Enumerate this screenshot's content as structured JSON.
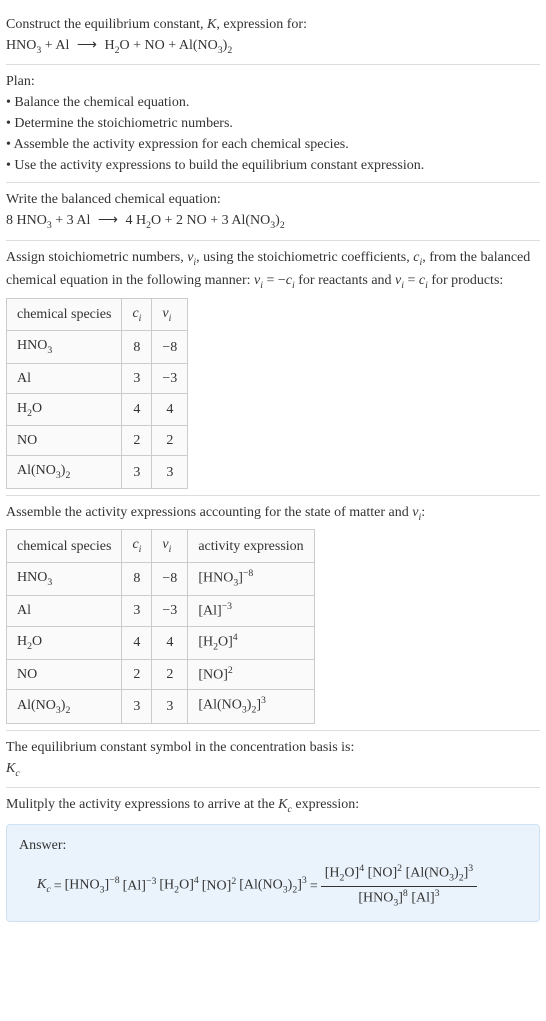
{
  "header": {
    "line1_a": "Construct the equilibrium constant, ",
    "line1_b": ", expression for:",
    "K": "K",
    "eq_lhs_1": "HNO",
    "eq_lhs_1_sub": "3",
    "plus": " + ",
    "eq_lhs_2": "Al",
    "arrow": "⟶",
    "eq_rhs_1": "H",
    "eq_rhs_1_sub": "2",
    "eq_rhs_1b": "O",
    "eq_rhs_2": "NO",
    "eq_rhs_3a": "Al(NO",
    "eq_rhs_3_sub1": "3",
    "eq_rhs_3b": ")",
    "eq_rhs_3_sub2": "2"
  },
  "plan": {
    "title": "Plan:",
    "b1": "• Balance the chemical equation.",
    "b2": "• Determine the stoichiometric numbers.",
    "b3": "• Assemble the activity expression for each chemical species.",
    "b4": "• Use the activity expressions to build the equilibrium constant expression."
  },
  "balanced": {
    "intro": "Write the balanced chemical equation:",
    "c1": "8 HNO",
    "c1_sub": "3",
    "c2": " + 3 Al",
    "arrow": "⟶",
    "c3": "4 H",
    "c3_sub": "2",
    "c3b": "O",
    "c4": " + 2 NO",
    "c5a": " + 3 Al(NO",
    "c5_sub1": "3",
    "c5b": ")",
    "c5_sub2": "2"
  },
  "stoich_intro": {
    "a": "Assign stoichiometric numbers, ",
    "nu": "ν",
    "i": "i",
    "b": ", using the stoichiometric coefficients, ",
    "c": "c",
    "d": ", from the balanced chemical equation in the following manner: ",
    "rule1a": "ν",
    "rule1b": " = −",
    "rule1c": "c",
    "e": " for reactants and ",
    "rule2a": "ν",
    "rule2b": " = ",
    "rule2c": "c",
    "f": " for products:"
  },
  "table1": {
    "h1": "chemical species",
    "h2_a": "c",
    "h2_b": "i",
    "h3_a": "ν",
    "h3_b": "i",
    "r1": {
      "sp_a": "HNO",
      "sp_sub": "3",
      "c": "8",
      "nu": "−8"
    },
    "r2": {
      "sp": "Al",
      "c": "3",
      "nu": "−3"
    },
    "r3": {
      "sp_a": "H",
      "sp_sub": "2",
      "sp_b": "O",
      "c": "4",
      "nu": "4"
    },
    "r4": {
      "sp": "NO",
      "c": "2",
      "nu": "2"
    },
    "r5": {
      "sp_a": "Al(NO",
      "sp_sub1": "3",
      "sp_b": ")",
      "sp_sub2": "2",
      "c": "3",
      "nu": "3"
    }
  },
  "activity_intro": {
    "a": "Assemble the activity expressions accounting for the state of matter and ",
    "nu": "ν",
    "i": "i",
    "b": ":"
  },
  "table2": {
    "h1": "chemical species",
    "h2_a": "c",
    "h2_b": "i",
    "h3_a": "ν",
    "h3_b": "i",
    "h4": "activity expression",
    "r1": {
      "sp_a": "HNO",
      "sp_sub": "3",
      "c": "8",
      "nu": "−8",
      "ae_a": "[HNO",
      "ae_sub": "3",
      "ae_b": "]",
      "ae_sup": "−8"
    },
    "r2": {
      "sp": "Al",
      "c": "3",
      "nu": "−3",
      "ae_a": "[Al]",
      "ae_sup": "−3"
    },
    "r3": {
      "sp_a": "H",
      "sp_sub": "2",
      "sp_b": "O",
      "c": "4",
      "nu": "4",
      "ae_a": "[H",
      "ae_sub": "2",
      "ae_b": "O]",
      "ae_sup": "4"
    },
    "r4": {
      "sp": "NO",
      "c": "2",
      "nu": "2",
      "ae_a": "[NO]",
      "ae_sup": "2"
    },
    "r5": {
      "sp_a": "Al(NO",
      "sp_sub1": "3",
      "sp_b": ")",
      "sp_sub2": "2",
      "c": "3",
      "nu": "3",
      "ae_a": "[Al(NO",
      "ae_sub1": "3",
      "ae_b": ")",
      "ae_sub2": "2",
      "ae_c": "]",
      "ae_sup": "3"
    }
  },
  "kc_intro": {
    "a": "The equilibrium constant symbol in the concentration basis is:",
    "k": "K",
    "c": "c"
  },
  "multiply": {
    "a": "Mulitply the activity expressions to arrive at the ",
    "k": "K",
    "c": "c",
    "b": " expression:"
  },
  "answer": {
    "title": "Answer:",
    "k": "K",
    "c": "c",
    "eq": " = ",
    "t1_a": "[HNO",
    "t1_sub": "3",
    "t1_b": "]",
    "t1_sup": "−8",
    "t2_a": " [Al]",
    "t2_sup": "−3",
    "t3_a": " [H",
    "t3_sub": "2",
    "t3_b": "O]",
    "t3_sup": "4",
    "t4_a": " [NO]",
    "t4_sup": "2",
    "t5_a": " [Al(NO",
    "t5_sub1": "3",
    "t5_b": ")",
    "t5_sub2": "2",
    "t5_c": "]",
    "t5_sup": "3",
    "eq2": " = ",
    "num_a": "[H",
    "num_sub1": "2",
    "num_b": "O]",
    "num_sup1": "4",
    "num_c": " [NO]",
    "num_sup2": "2",
    "num_d": " [Al(NO",
    "num_sub2": "3",
    "num_e": ")",
    "num_sub3": "2",
    "num_f": "]",
    "num_sup3": "3",
    "den_a": "[HNO",
    "den_sub1": "3",
    "den_b": "]",
    "den_sup1": "8",
    "den_c": " [Al]",
    "den_sup2": "3"
  }
}
